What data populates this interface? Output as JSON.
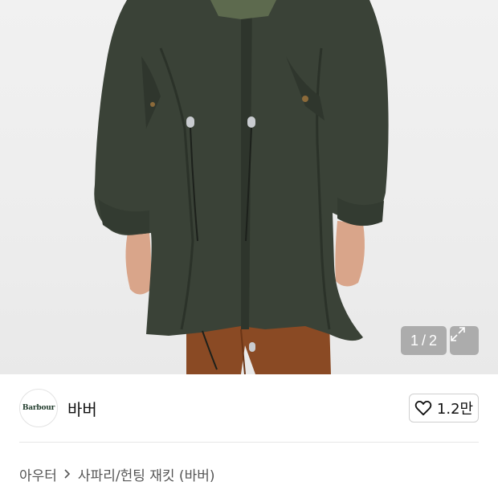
{
  "gallery": {
    "current": "1",
    "separator": "/",
    "total": "2",
    "expand_icon": "expand-arrows-icon"
  },
  "brand": {
    "logo_text": "Barbour",
    "name": "바버"
  },
  "like": {
    "icon": "heart-outline-icon",
    "count": "1.2만"
  },
  "breadcrumb": {
    "category": "아우터",
    "separator_icon": "chevron-right-icon",
    "subcategory": "사파리/헌팅 재킷 (바버)"
  },
  "colors": {
    "jacket": "#3a4237",
    "background": "#efefef",
    "pants": "#8a4a24",
    "overlay": "rgba(120,120,120,0.55)"
  }
}
